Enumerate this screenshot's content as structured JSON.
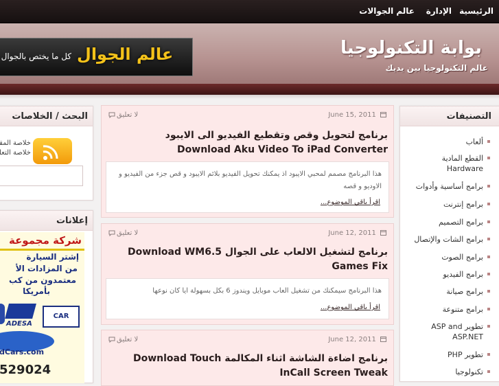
{
  "nav": {
    "items": [
      "الرئيسية",
      "الإدارة",
      "عالم الجوالات"
    ]
  },
  "header": {
    "title": "بوابة التكنولوجيا",
    "tagline": "عالم التكنولوجيا بين يديك",
    "banner": {
      "logo_text": "عالم الجوال",
      "text": "كل ما يختص بالجوال"
    }
  },
  "right_sidebar": {
    "title": "التصنيفات",
    "categories": [
      "ألعاب",
      "القطع المادية Hardware",
      "برامج أساسية وأدوات",
      "برامج إنترنت",
      "برامج التصميم",
      "برامج الشات والإتصال",
      "برامج الصوت",
      "برامج الفيديو",
      "برامج صيانة",
      "برامج متنوعة",
      "تطوير ASP and ASP.NET",
      "تطوير PHP",
      "تكنولوجيا"
    ]
  },
  "left_sidebar": {
    "search_title": "البحث / الخلاصات",
    "feed_links": [
      "خلاصة المقالات",
      "خلاصة التعليقات"
    ],
    "ads_title": "إعلانات",
    "ad": {
      "line1": "شركة مجموعة",
      "line2": "إشتر السيارة",
      "line3": "من المزادات الأ",
      "line4": "معتمدون من كب",
      "line5": "بأمريكا",
      "brand1": "ADESA",
      "brand2": "CAR",
      "site": "dCars.com",
      "phone": "529024"
    }
  },
  "posts": [
    {
      "date": "June 15, 2011",
      "comments": "لا تعليق",
      "title_ar": "برنامج لتحويل وقص وتقطيع الفيديو الى الايبود",
      "title_en": "Download Aku Video To iPad Converter",
      "excerpt": "هذا البرنامج مصمم لمحبي الايبود اذ يمكنك تحويل الفيديو بلائم الايبود و قص جزء من الفيديو و الاوديو و قصه",
      "readmore": "اقرأ باقي الموضوع..."
    },
    {
      "date": "June 12, 2011",
      "comments": "لا تعليق",
      "title_line1": "برنامج لتشغيل الالعاب على الجوال Download WM6.5",
      "title_line2": "Games Fix",
      "excerpt": "هذا البرنامج سيمكنك من تشغيل العاب موبايل ويندوز 6 بكل بسهولة ايا كان نوعها",
      "readmore": "اقرأ باقي الموضوع..."
    },
    {
      "date": "June 12, 2011",
      "comments": "لا تعليق",
      "title_line1": "برنامج اضاءة الشاشة اثناء المكالمة Download Touch",
      "title_line2": "InCall Screen Tweak"
    }
  ],
  "colors": {
    "nav_bg": "#1c1414",
    "header_bg": "#b69290",
    "header_band": "#5a2020",
    "post_bg": "#fde9e9",
    "accent": "#f4c21a"
  }
}
